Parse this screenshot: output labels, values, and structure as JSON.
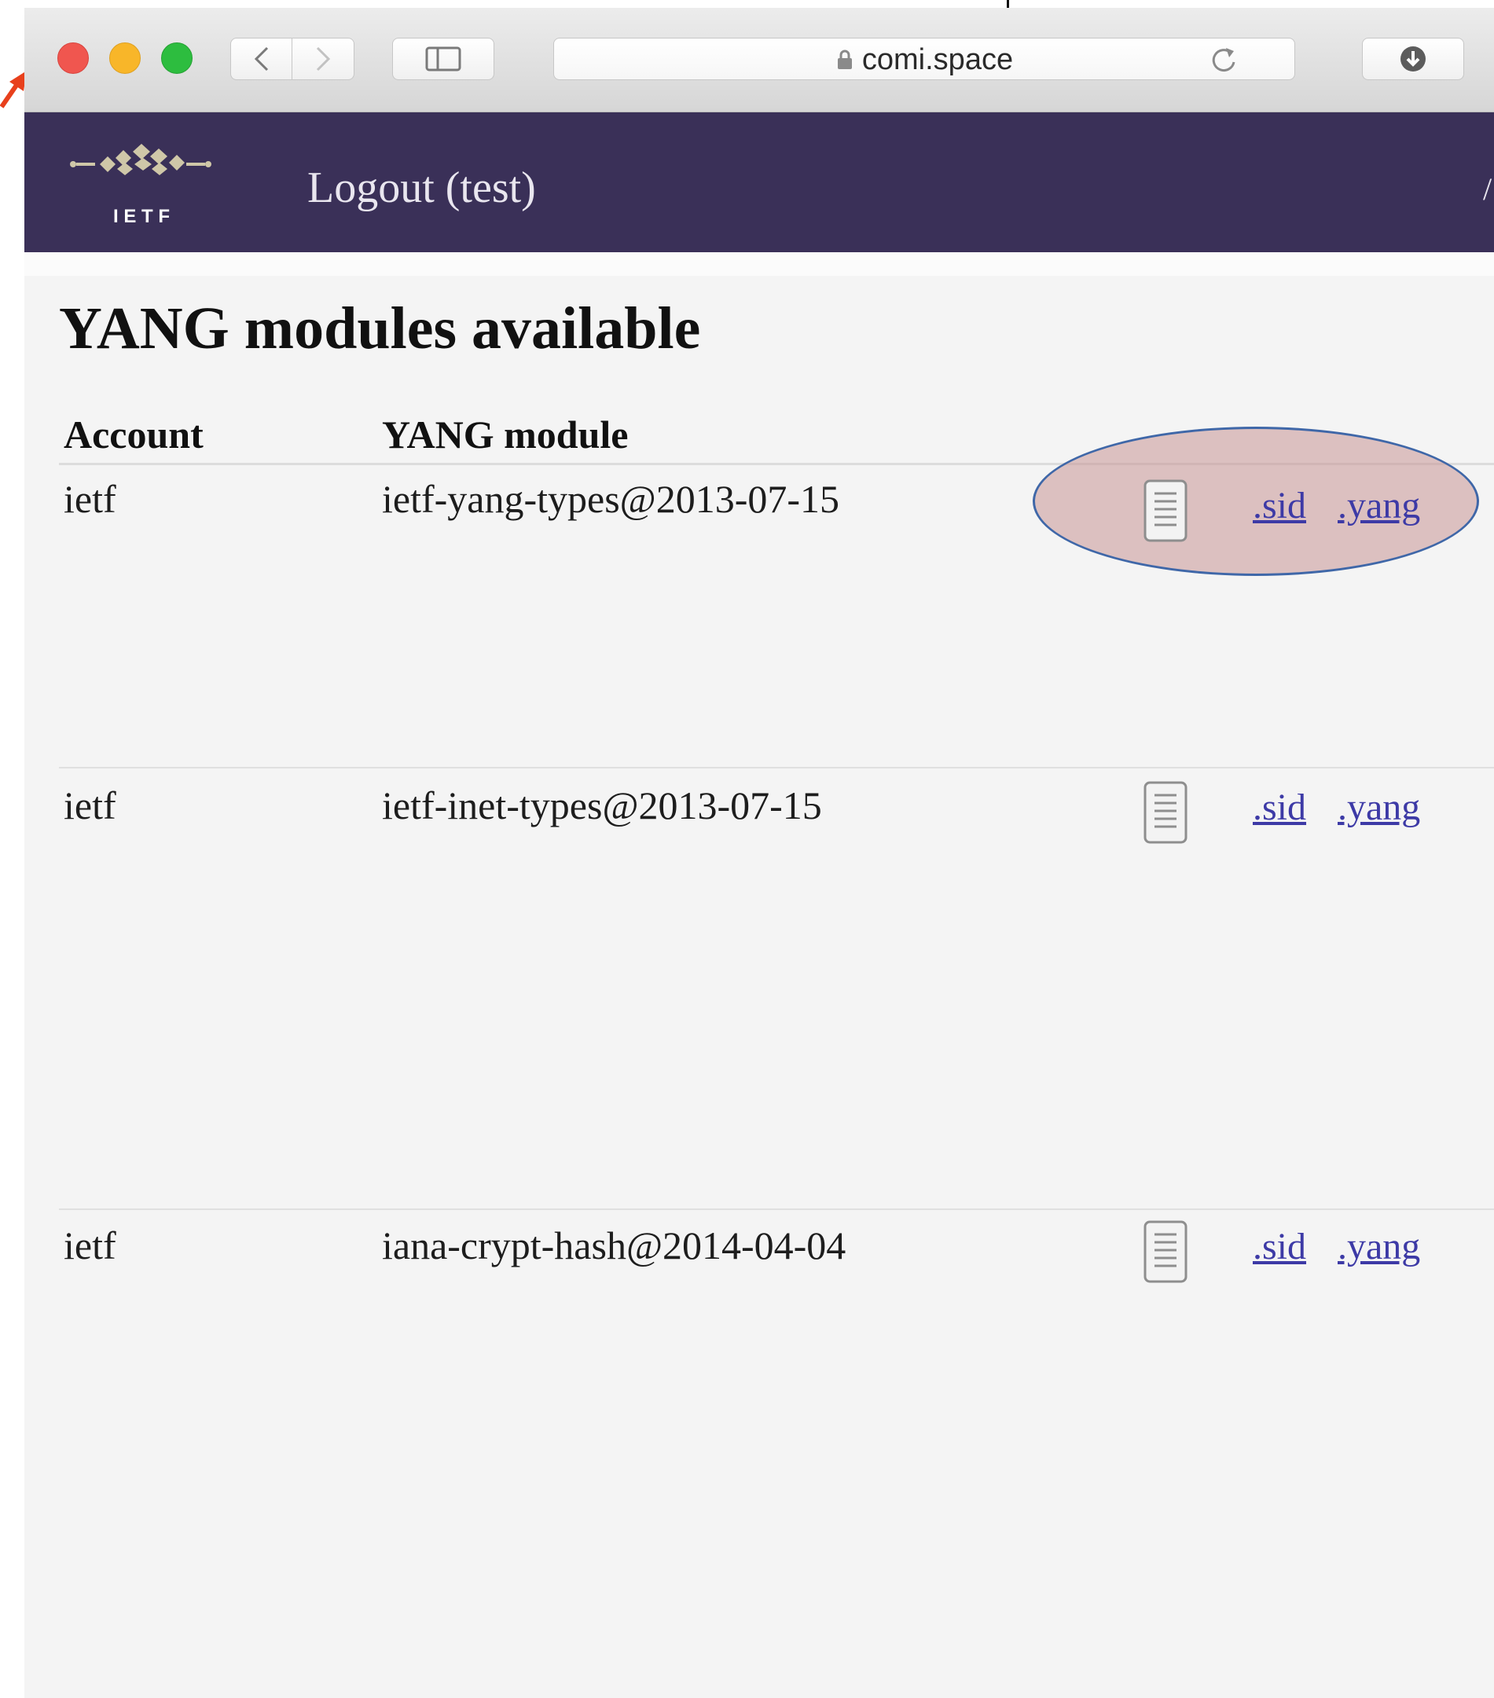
{
  "browser": {
    "url": "comi.space",
    "icons": {
      "back": "chevron-left-icon",
      "forward": "chevron-right-icon",
      "sidebar": "sidebar-icon",
      "lock": "lock-icon",
      "reload": "reload-icon",
      "download": "download-icon"
    }
  },
  "header": {
    "logo_text": "I E T F",
    "logout_label": "Logout (test)",
    "background_color": "#3a3058"
  },
  "main": {
    "title": "YANG modules available",
    "columns": [
      "Account",
      "YANG module"
    ],
    "rows": [
      {
        "account": "ietf",
        "module": "ietf-yang-types@2013-07-15",
        "sid_link": ".sid",
        "yang_link": ".yang"
      },
      {
        "account": "ietf",
        "module": "ietf-inet-types@2013-07-15",
        "sid_link": ".sid",
        "yang_link": ".yang"
      },
      {
        "account": "ietf",
        "module": "iana-crypt-hash@2014-04-04",
        "sid_link": ".sid",
        "yang_link": ".yang"
      }
    ]
  },
  "annotations": {
    "highlight_color": "#c89696",
    "arrow_color": "#e8401c"
  }
}
